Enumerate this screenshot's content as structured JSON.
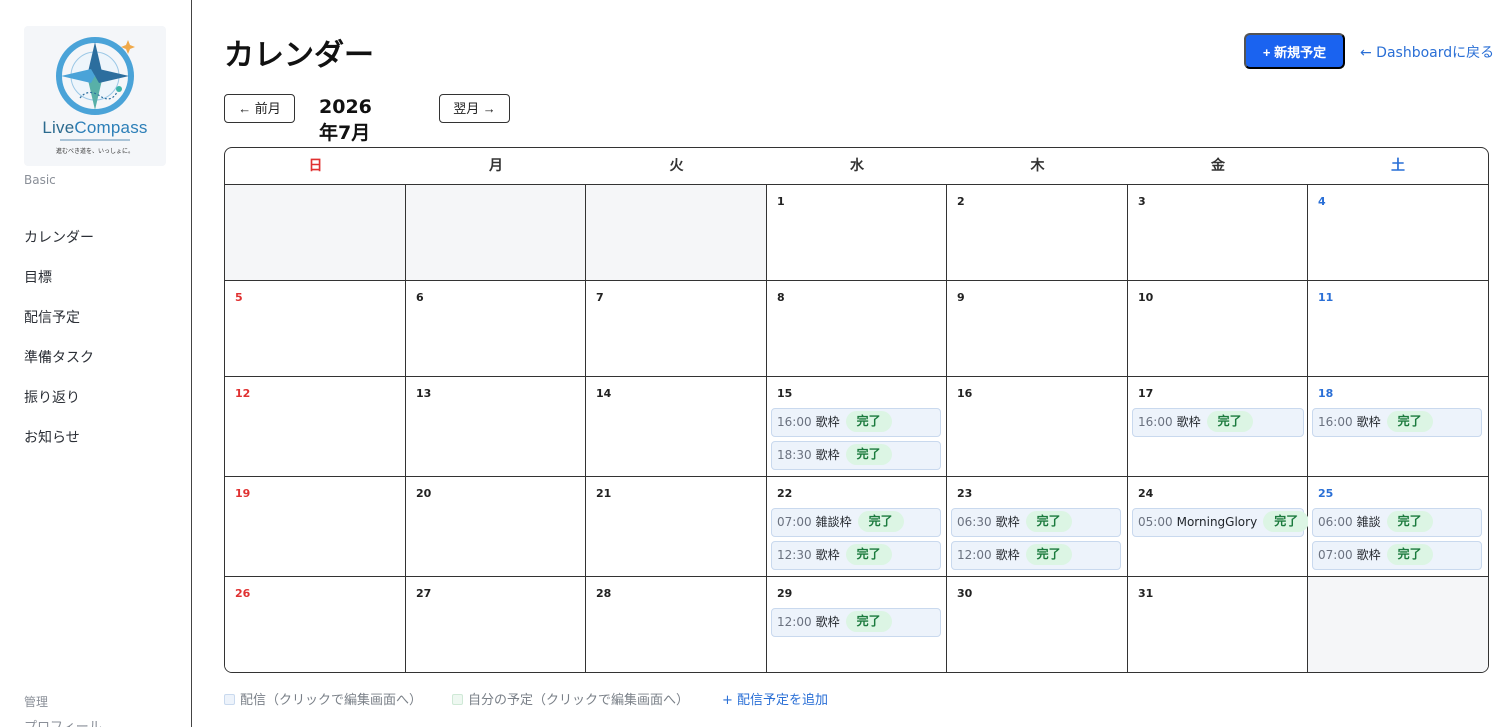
{
  "sidebar": {
    "logo": {
      "word_live": "Live",
      "word_compass": "Compass",
      "tagline": "進むべき道を、いっしょに。"
    },
    "plan": "Basic",
    "items": [
      {
        "label": "カレンダー"
      },
      {
        "label": "目標"
      },
      {
        "label": "配信予定"
      },
      {
        "label": "準備タスク"
      },
      {
        "label": "振り返り"
      },
      {
        "label": "お知らせ"
      }
    ],
    "admin_label": "管理",
    "profile": "プロフィール"
  },
  "header": {
    "title": "カレンダー",
    "new_button": "+ 新規予定",
    "back_link": "← Dashboardに戻る"
  },
  "month_nav": {
    "prev": "← 前月",
    "current": "2026年7月",
    "next": "翌月 →"
  },
  "calendar": {
    "weekdays": [
      "日",
      "月",
      "火",
      "水",
      "木",
      "金",
      "土"
    ],
    "weekday_colors": {
      "sun": "#e03131",
      "sat": "#2a6fd6",
      "default": "#333333"
    },
    "weeks": [
      [
        {
          "day": "",
          "events": []
        },
        {
          "day": "",
          "events": []
        },
        {
          "day": "",
          "events": []
        },
        {
          "day": "1",
          "events": []
        },
        {
          "day": "2",
          "events": []
        },
        {
          "day": "3",
          "events": []
        },
        {
          "day": "4",
          "events": []
        }
      ],
      [
        {
          "day": "5",
          "events": []
        },
        {
          "day": "6",
          "events": []
        },
        {
          "day": "7",
          "events": []
        },
        {
          "day": "8",
          "events": []
        },
        {
          "day": "9",
          "events": []
        },
        {
          "day": "10",
          "events": []
        },
        {
          "day": "11",
          "events": []
        }
      ],
      [
        {
          "day": "12",
          "events": []
        },
        {
          "day": "13",
          "events": []
        },
        {
          "day": "14",
          "events": []
        },
        {
          "day": "15",
          "events": [
            {
              "time": "16:00",
              "title": "歌枠",
              "status": "完了"
            },
            {
              "time": "18:30",
              "title": "歌枠",
              "status": "完了"
            }
          ]
        },
        {
          "day": "16",
          "events": []
        },
        {
          "day": "17",
          "events": [
            {
              "time": "16:00",
              "title": "歌枠",
              "status": "完了"
            }
          ]
        },
        {
          "day": "18",
          "events": [
            {
              "time": "16:00",
              "title": "歌枠",
              "status": "完了"
            }
          ]
        }
      ],
      [
        {
          "day": "19",
          "events": []
        },
        {
          "day": "20",
          "events": []
        },
        {
          "day": "21",
          "events": []
        },
        {
          "day": "22",
          "events": [
            {
              "time": "07:00",
              "title": "雑談枠",
              "status": "完了"
            },
            {
              "time": "12:30",
              "title": "歌枠",
              "status": "完了"
            }
          ]
        },
        {
          "day": "23",
          "events": [
            {
              "time": "06:30",
              "title": "歌枠",
              "status": "完了"
            },
            {
              "time": "12:00",
              "title": "歌枠",
              "status": "完了"
            }
          ]
        },
        {
          "day": "24",
          "events": [
            {
              "time": "05:00",
              "title": "MorningGlory",
              "status": "完了"
            }
          ]
        },
        {
          "day": "25",
          "events": [
            {
              "time": "06:00",
              "title": "雑談",
              "status": "完了"
            },
            {
              "time": "07:00",
              "title": "歌枠",
              "status": "完了"
            }
          ]
        }
      ],
      [
        {
          "day": "26",
          "events": []
        },
        {
          "day": "27",
          "events": []
        },
        {
          "day": "28",
          "events": []
        },
        {
          "day": "29",
          "events": [
            {
              "time": "12:00",
              "title": "歌枠",
              "status": "完了"
            }
          ]
        },
        {
          "day": "30",
          "events": []
        },
        {
          "day": "31",
          "events": []
        },
        {
          "day": "",
          "events": []
        }
      ]
    ]
  },
  "legend": {
    "stream": "配信（クリックで編集画面へ）",
    "personal": "自分の予定（クリックで編集画面へ）",
    "add_link": "+ 配信予定を追加"
  },
  "colors": {
    "accent": "#1a63f0",
    "link": "#2a6fd6",
    "event_bg": "#edf3fb",
    "badge_bg": "#dcf5e4",
    "badge_text": "#1b7a3d"
  }
}
